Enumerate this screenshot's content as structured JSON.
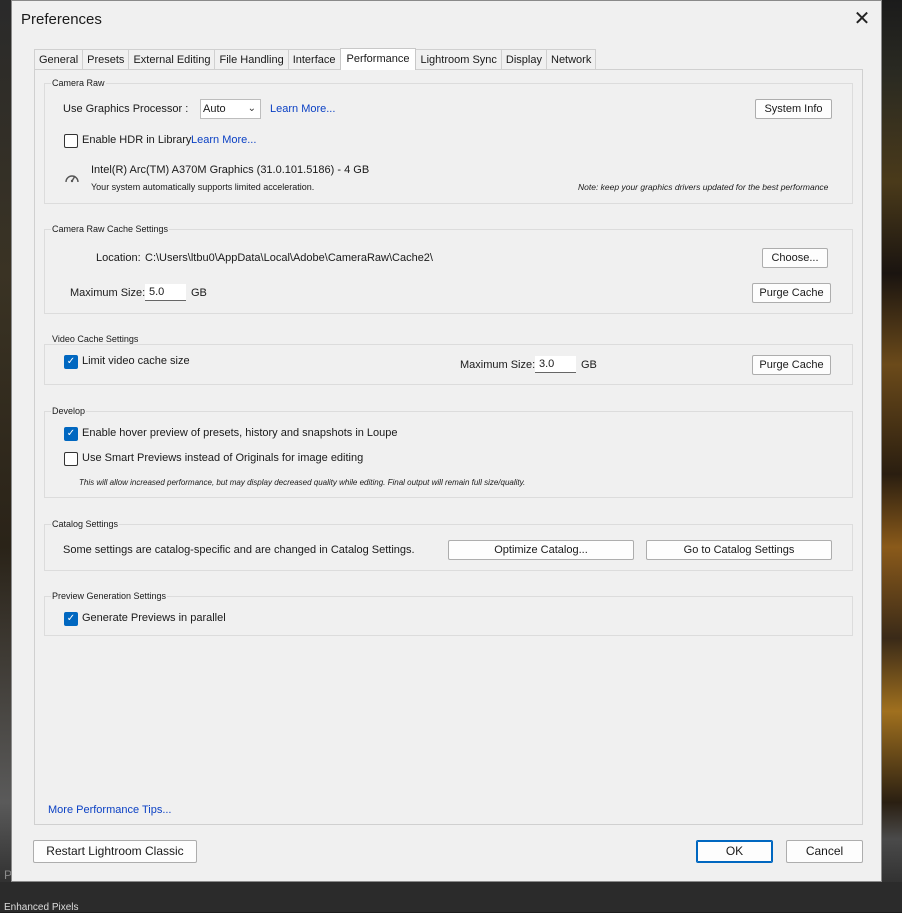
{
  "dialog": {
    "title": "Preferences"
  },
  "tabs": [
    "General",
    "Presets",
    "External Editing",
    "File Handling",
    "Interface",
    "Performance",
    "Lightroom Sync",
    "Display",
    "Network"
  ],
  "camera_raw": {
    "label": "Camera Raw",
    "gpu_label": "Use Graphics Processor :",
    "gpu_value": "Auto",
    "learn_more": "Learn More...",
    "system_info": "System Info",
    "hdr_label": "Enable HDR in Library",
    "hdr_learn_more": "Learn More...",
    "gpu_name": "Intel(R) Arc(TM) A370M Graphics (31.0.101.5186) - 4 GB",
    "gpu_status": "Your system automatically supports limited acceleration.",
    "gpu_note": "Note: keep your graphics drivers updated for the best performance"
  },
  "cache": {
    "label": "Camera Raw Cache Settings",
    "location_label": "Location:",
    "location_value": "C:\\Users\\ltbu0\\AppData\\Local\\Adobe\\CameraRaw\\Cache2\\",
    "choose": "Choose...",
    "max_label": "Maximum Size:",
    "max_value": "5.0",
    "unit": "GB",
    "purge": "Purge Cache"
  },
  "video": {
    "label": "Video Cache Settings",
    "limit_label": "Limit video cache size",
    "max_label": "Maximum Size:",
    "max_value": "3.0",
    "unit": "GB",
    "purge": "Purge Cache"
  },
  "develop": {
    "label": "Develop",
    "hover_label": "Enable hover preview of presets, history and snapshots in Loupe",
    "smart_label": "Use Smart Previews instead of Originals for image editing",
    "smart_note": "This will allow increased performance, but may display decreased quality while editing. Final output will remain full size/quality."
  },
  "catalog": {
    "label": "Catalog Settings",
    "text": "Some settings are catalog-specific and are changed in Catalog Settings.",
    "optimize": "Optimize Catalog...",
    "goto": "Go to Catalog Settings"
  },
  "preview": {
    "label": "Preview Generation Settings",
    "parallel_label": "Generate Previews in parallel"
  },
  "tips_link": "More Performance Tips...",
  "footer": {
    "restart": "Restart Lightroom Classic",
    "ok": "OK",
    "cancel": "Cancel"
  },
  "background": {
    "bottom_text": "P",
    "bottom_text2": "Enhanced Pixels"
  },
  "colors": {
    "accent": "#0067c0",
    "link": "#0b41c4"
  }
}
